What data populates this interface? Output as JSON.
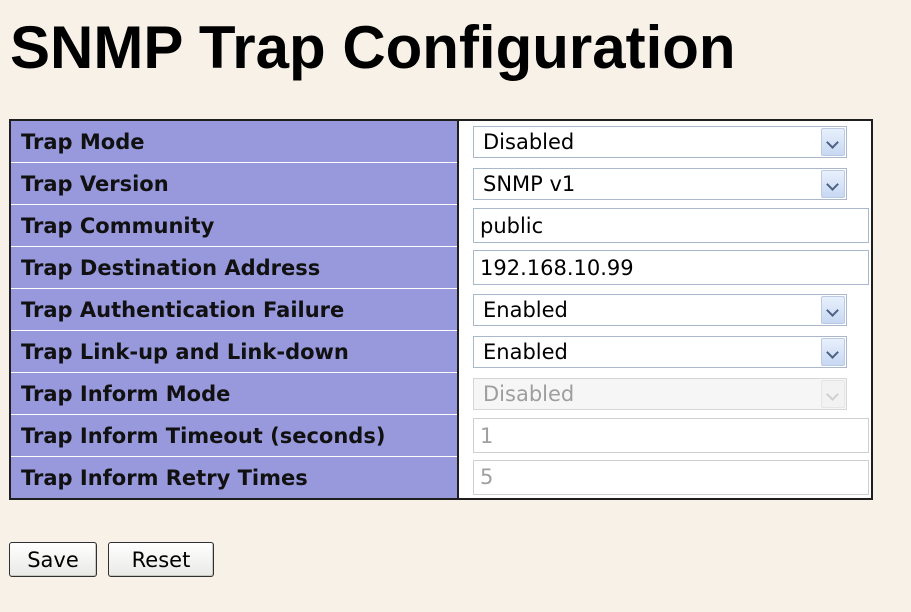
{
  "page": {
    "title": "SNMP Trap Configuration"
  },
  "fields": [
    {
      "label": "Trap Mode",
      "type": "select",
      "value": "Disabled",
      "enabled": true
    },
    {
      "label": "Trap Version",
      "type": "select",
      "value": "SNMP v1",
      "enabled": true
    },
    {
      "label": "Trap Community",
      "type": "text",
      "value": "public",
      "enabled": true
    },
    {
      "label": "Trap Destination Address",
      "type": "text",
      "value": "192.168.10.99",
      "enabled": true
    },
    {
      "label": "Trap Authentication Failure",
      "type": "select",
      "value": "Enabled",
      "enabled": true
    },
    {
      "label": "Trap Link-up and Link-down",
      "type": "select",
      "value": "Enabled",
      "enabled": true
    },
    {
      "label": "Trap Inform Mode",
      "type": "select",
      "value": "Disabled",
      "enabled": false
    },
    {
      "label": "Trap Inform Timeout (seconds)",
      "type": "text",
      "value": "1",
      "enabled": false
    },
    {
      "label": "Trap Inform Retry Times",
      "type": "text",
      "value": "5",
      "enabled": false
    }
  ],
  "buttons": {
    "save_label": "Save",
    "reset_label": "Reset"
  },
  "colors": {
    "label_background": "#9898dc",
    "page_background": "#f7f1e8"
  }
}
